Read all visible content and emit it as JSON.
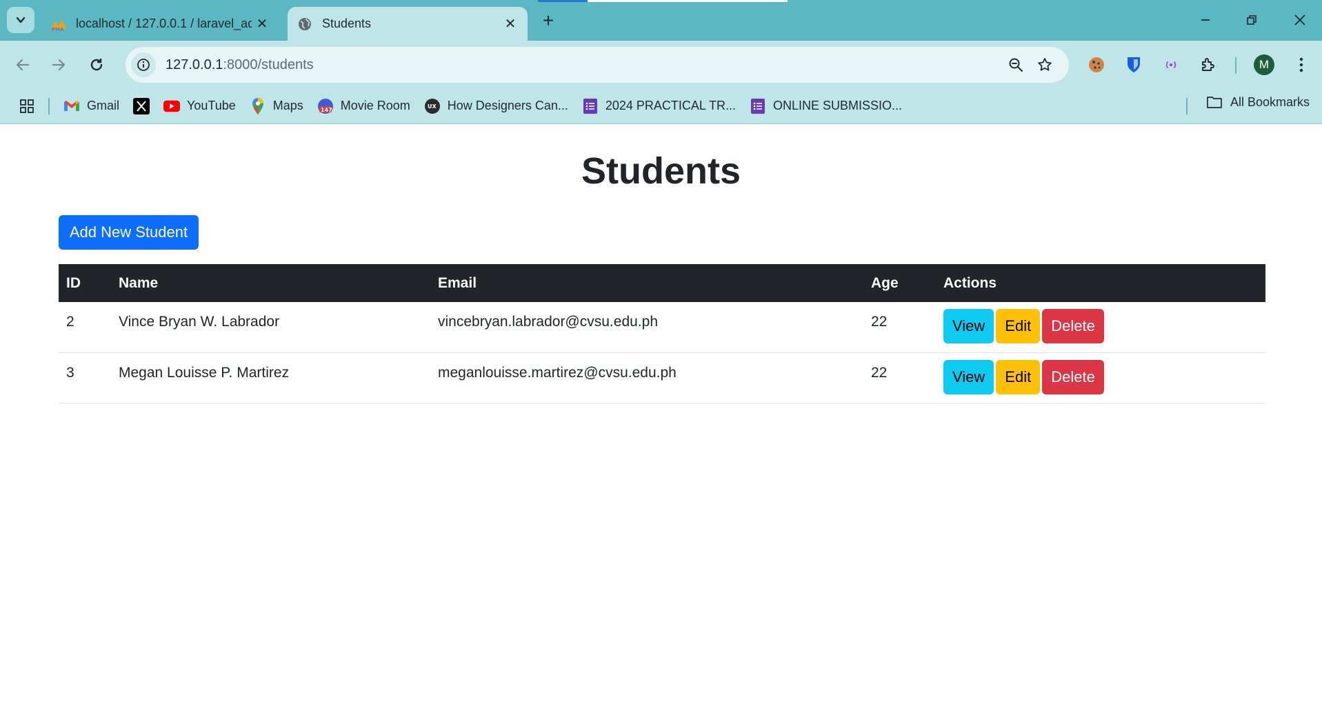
{
  "browser": {
    "tabs": [
      {
        "title": "localhost / 127.0.0.1 / laravel_ac",
        "favicon": "phpmyadmin-icon",
        "active": false
      },
      {
        "title": "Students",
        "favicon": "globe-icon",
        "active": true
      }
    ],
    "url": {
      "host": "127.0.0.1",
      "path": ":8000/students"
    },
    "avatar_letter": "M",
    "bookmarks": [
      {
        "label": "Gmail",
        "icon": "gmail-icon"
      },
      {
        "label": "",
        "icon": "x-icon"
      },
      {
        "label": "YouTube",
        "icon": "youtube-icon"
      },
      {
        "label": "Maps",
        "icon": "maps-icon"
      },
      {
        "label": "Movie Room",
        "icon": "movie-room-icon"
      },
      {
        "label": "How Designers Can...",
        "icon": "ux-icon"
      },
      {
        "label": "2024 PRACTICAL TR...",
        "icon": "forms-icon"
      },
      {
        "label": "ONLINE SUBMISSIO...",
        "icon": "forms-icon"
      }
    ],
    "all_bookmarks": "All Bookmarks"
  },
  "page": {
    "title": "Students",
    "add_button": "Add New Student",
    "columns": [
      "ID",
      "Name",
      "Email",
      "Age",
      "Actions"
    ],
    "rows": [
      {
        "id": "2",
        "name": "Vince Bryan W. Labrador",
        "email": "vincebryan.labrador@cvsu.edu.ph",
        "age": "22"
      },
      {
        "id": "3",
        "name": "Megan Louisse P. Martirez",
        "email": "meganlouisse.martirez@cvsu.edu.ph",
        "age": "22"
      }
    ],
    "actions": {
      "view": "View",
      "edit": "Edit",
      "delete": "Delete"
    }
  },
  "colors": {
    "primary": "#0d6efd",
    "info": "#0dcaf0",
    "warning": "#ffc107",
    "danger": "#dc3545",
    "table_header": "#212529",
    "browser_frame": "#5bb8c3"
  }
}
